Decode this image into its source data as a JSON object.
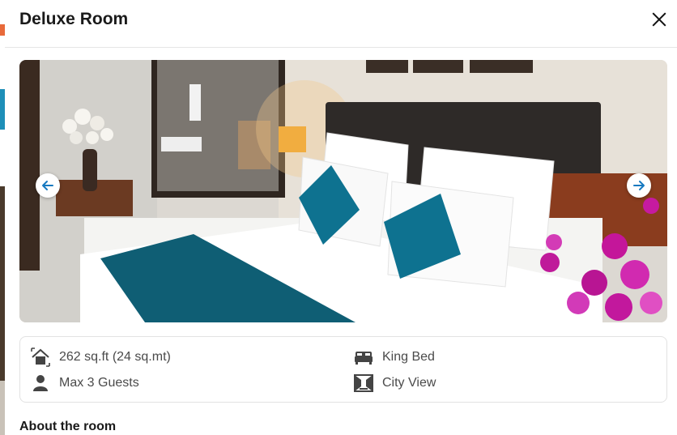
{
  "modal": {
    "title": "Deluxe Room"
  },
  "amenities": [
    {
      "icon": "area-icon",
      "label": "262 sq.ft (24 sq.mt)"
    },
    {
      "icon": "bed-icon",
      "label": "King Bed"
    },
    {
      "icon": "person-icon",
      "label": "Max 3 Guests"
    },
    {
      "icon": "view-icon",
      "label": "City View"
    }
  ],
  "section": {
    "about_title": "About the room"
  },
  "colors": {
    "accent": "#1679c0",
    "text": "#4a4a4a",
    "throw": "#0f5e74"
  }
}
